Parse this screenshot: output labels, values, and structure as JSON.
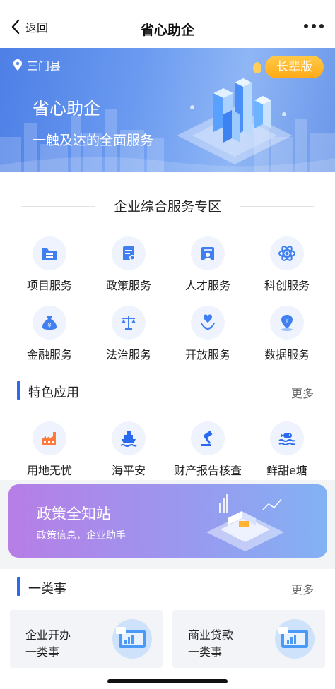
{
  "header": {
    "back_label": "返回",
    "title": "省心助企"
  },
  "banner": {
    "location": "三门县",
    "elder_mode": "长辈版",
    "title": "省心助企",
    "subtitle": "一触及达的全面服务"
  },
  "services": {
    "heading": "企业综合服务专区",
    "row1": [
      {
        "label": "项目服务",
        "icon": "folder-icon"
      },
      {
        "label": "政策服务",
        "icon": "policy-doc-icon"
      },
      {
        "label": "人才服务",
        "icon": "id-card-icon"
      },
      {
        "label": "科创服务",
        "icon": "atom-icon"
      }
    ],
    "row2": [
      {
        "label": "金融服务",
        "icon": "money-bag-icon"
      },
      {
        "label": "法治服务",
        "icon": "scales-icon"
      },
      {
        "label": "开放服务",
        "icon": "heart-hands-icon"
      },
      {
        "label": "数据服务",
        "icon": "data-pin-icon"
      }
    ]
  },
  "featured": {
    "heading": "特色应用",
    "more": "更多",
    "items": [
      {
        "label": "用地无忧",
        "icon": "factory-icon"
      },
      {
        "label": "海平安",
        "icon": "ship-icon"
      },
      {
        "label": "财产报告核查",
        "icon": "gavel-icon"
      },
      {
        "label": "鲜甜e塘",
        "icon": "fish-wave-icon"
      }
    ]
  },
  "policy_banner": {
    "title": "政策全知站",
    "subtitle": "政策信息，企业助手"
  },
  "category": {
    "heading": "一类事",
    "more": "更多",
    "cards": [
      {
        "line1": "企业开办",
        "line2": "一类事"
      },
      {
        "line1": "商业贷款",
        "line2": "一类事"
      }
    ]
  },
  "colors": {
    "accent": "#2a6af0",
    "elder_button": "#ffaa14",
    "banner": "#6a9af0"
  }
}
